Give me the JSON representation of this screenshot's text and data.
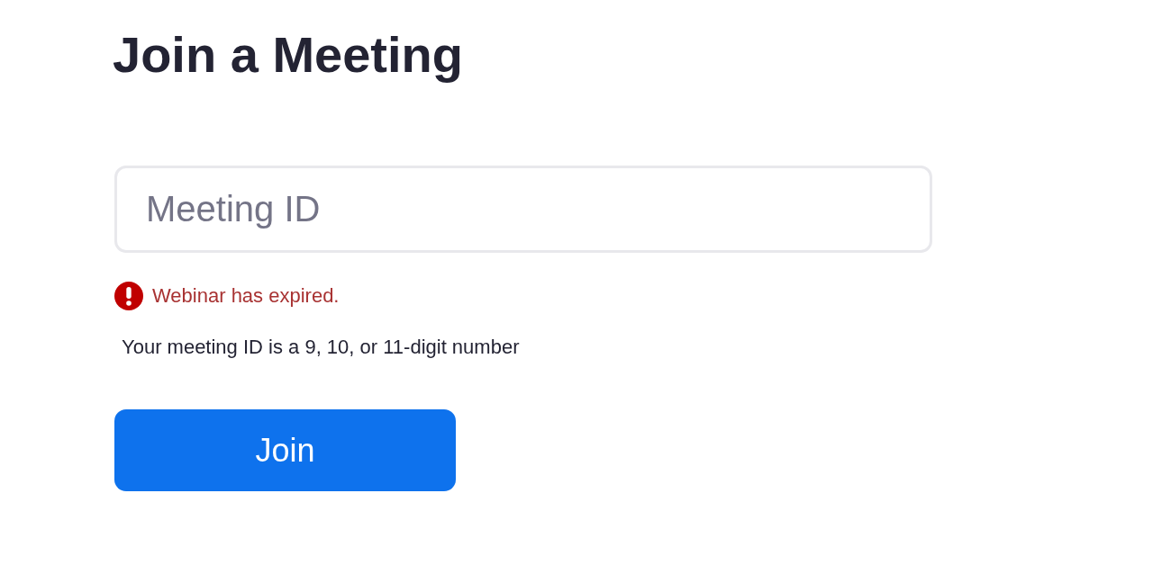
{
  "heading": "Join a Meeting",
  "meeting_id_field": {
    "placeholder": "Meeting ID"
  },
  "error": {
    "message": "Webinar has expired."
  },
  "hint": "Your meeting ID is a 9, 10, or 11-digit number",
  "join_button": {
    "label": "Join"
  }
}
